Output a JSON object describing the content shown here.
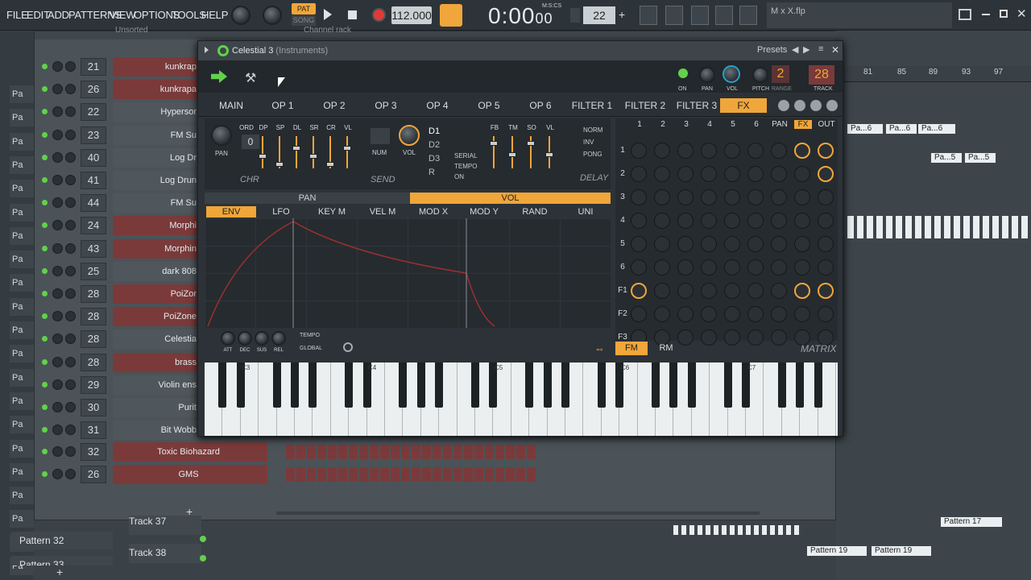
{
  "menu": [
    "FILE",
    "EDIT",
    "ADD",
    "PATTERNS",
    "VIEW",
    "OPTIONS",
    "TOOLS",
    "HELP"
  ],
  "transport": {
    "pat": "PAT",
    "song": "SONG",
    "tempo": "112.000",
    "time": "0:00",
    "time_sub": "00",
    "time_units": "M:S:CS",
    "step": "22"
  },
  "hint": "M x X.flp",
  "browser": [
    "Pa",
    "Pa",
    "Pa",
    "Pa",
    "Pa",
    "Pa",
    "Pa",
    "Pa",
    "Pa",
    "Pa",
    "Pa",
    "Pa",
    "Pa",
    "Pa",
    "Pa",
    "Pa",
    "Pa",
    "Pa",
    "Pa",
    "Pa",
    "Pa"
  ],
  "rack": {
    "title": "Channel rack",
    "unsorted": "Unsorted",
    "channels": [
      {
        "num": "21",
        "name": "kunkrap",
        "color": "#7a3a3a"
      },
      {
        "num": "26",
        "name": "kunkrapa",
        "color": "#7a3a3a"
      },
      {
        "num": "22",
        "name": "Hypersor",
        "color": "#4f575c"
      },
      {
        "num": "23",
        "name": "FM Su",
        "color": "#4f575c"
      },
      {
        "num": "40",
        "name": "Log Dr",
        "color": "#4f575c"
      },
      {
        "num": "41",
        "name": "Log Drun",
        "color": "#4f575c"
      },
      {
        "num": "44",
        "name": "FM Su",
        "color": "#4f575c"
      },
      {
        "num": "24",
        "name": "Morphi",
        "color": "#7a3a3a"
      },
      {
        "num": "43",
        "name": "Morphin",
        "color": "#7a3a3a"
      },
      {
        "num": "25",
        "name": "dark 808",
        "color": "#4f575c"
      },
      {
        "num": "28",
        "name": "PoiZor",
        "color": "#7a3a3a"
      },
      {
        "num": "28",
        "name": "PoiZone",
        "color": "#7a3a3a"
      },
      {
        "num": "28",
        "name": "Celestia",
        "color": "#4f575c"
      },
      {
        "num": "28",
        "name": "brass",
        "color": "#7a3a3a"
      },
      {
        "num": "29",
        "name": "Violin ens",
        "color": "#4f575c"
      },
      {
        "num": "30",
        "name": "Purit",
        "color": "#4f575c"
      },
      {
        "num": "31",
        "name": "Bit Wobb",
        "color": "#4f575c"
      },
      {
        "num": "32",
        "name": "Toxic Biohazard",
        "color": "#7a3a3a"
      },
      {
        "num": "26",
        "name": "GMS",
        "color": "#7a3a3a"
      }
    ],
    "add": "+"
  },
  "playlist": {
    "ruler": [
      "81",
      "85",
      "89",
      "93",
      "97"
    ],
    "tracks": [
      "Track 37",
      "Track 38"
    ],
    "bottom_patterns": [
      "Pattern 32",
      "Pattern 33"
    ],
    "clips": [
      "Pa...6",
      "Pa...6",
      "Pa...6",
      "Pa...5",
      "Pa...5",
      "Pattern 17",
      "Pattern 19",
      "Pattern 19"
    ]
  },
  "plugin": {
    "title": "Celestial 3",
    "subtitle": "(Instruments)",
    "presets": "Presets",
    "on": "ON",
    "pan": "PAN",
    "vol": "VOL",
    "pitch": "PITCH",
    "range": "RANGE",
    "track": "TRACK",
    "range_val": "2",
    "track_val": "28",
    "tabs": [
      "MAIN",
      "OP 1",
      "OP 2",
      "OP 3",
      "OP 4",
      "OP 5",
      "OP 6",
      "FILTER 1",
      "FILTER 2",
      "FILTER 3",
      "FX"
    ],
    "chorus": {
      "pan": "PAN",
      "labels": [
        "ORD",
        "DP",
        "SP",
        "DL",
        "SR",
        "CR",
        "VL"
      ],
      "ord": "0",
      "chr": "CHR"
    },
    "send": {
      "num": "NUM",
      "vol": "VOL",
      "send": "SEND",
      "d": [
        "D1",
        "D2",
        "D3",
        "R"
      ],
      "modes": [
        "SERIAL",
        "TEMPO",
        "ON"
      ]
    },
    "delay": {
      "labels": [
        "FB",
        "TM",
        "SO",
        "VL"
      ],
      "modes": [
        "NORM",
        "INV",
        "PONG"
      ],
      "title": "DELAY"
    },
    "panvol": [
      "PAN",
      "VOL"
    ],
    "mod_tabs": [
      "ENV",
      "LFO",
      "KEY M",
      "VEL M",
      "MOD X",
      "MOD Y",
      "RAND",
      "UNI"
    ],
    "env_knobs": [
      "ATT",
      "DEC",
      "SUS",
      "REL"
    ],
    "env_opts": [
      "TEMPO",
      "GLOBAL"
    ],
    "matrix": {
      "cols": [
        "1",
        "2",
        "3",
        "4",
        "5",
        "6",
        "PAN",
        "FX",
        "OUT"
      ],
      "rows": [
        "1",
        "2",
        "3",
        "4",
        "5",
        "6",
        "F1",
        "F2",
        "F3"
      ],
      "fm": "FM",
      "rm": "RM",
      "title": "MATRIX"
    },
    "piano": [
      "C3",
      "C4",
      "C5",
      "C6",
      "C7"
    ]
  }
}
